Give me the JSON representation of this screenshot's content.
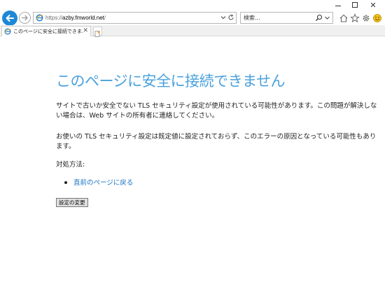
{
  "window": {
    "controls": [
      "minimize",
      "maximize",
      "close"
    ],
    "close_label": "✕"
  },
  "navbar": {
    "url_scheme": "https://",
    "url_host": "azby.fmworld.net",
    "url_path": "/",
    "search_placeholder": "検索...",
    "icons": [
      "back-arrow-icon",
      "forward-arrow-icon",
      "ie-site-icon",
      "dropdown-icon",
      "refresh-icon",
      "search-icon",
      "home-icon",
      "favorites-star-icon",
      "settings-gear-icon",
      "feedback-smiley-icon"
    ]
  },
  "tabs": [
    {
      "title": "このページに安全に接続できま...",
      "close_label": "✕",
      "active": true
    }
  ],
  "page": {
    "title": "このページに安全に接続できません",
    "paragraph1": "サイトで古いか安全でない TLS セキュリティ設定が使用されている可能性があります。この問題が解決しない場合は、Web サイトの所有者に連絡してください。",
    "paragraph2": "お使いの TLS セキュリティ設定は既定値に設定されておらず、このエラーの原因となっている可能性もあります。",
    "paragraph3": "対処方法:",
    "back_link": "直前のページに戻る",
    "settings_button": "設定の変更"
  },
  "colors": {
    "accent_blue": "#1e88d6",
    "title_blue": "#4aa1dc",
    "link_blue": "#1a74c4"
  }
}
